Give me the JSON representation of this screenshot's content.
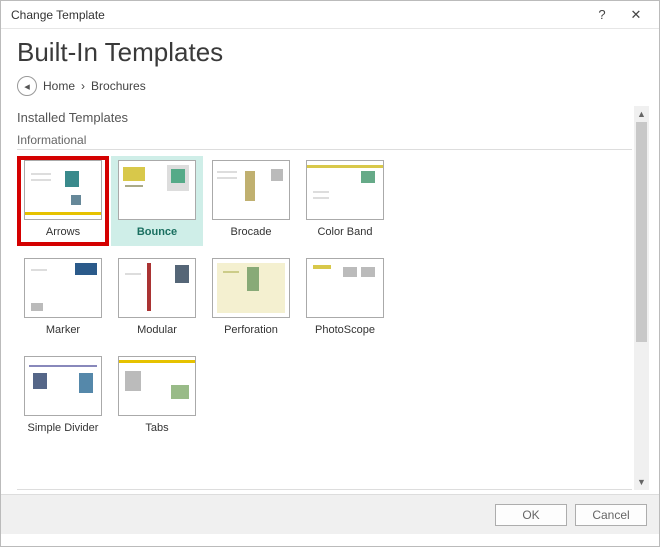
{
  "window": {
    "title": "Change Template",
    "help": "?",
    "close": "✕"
  },
  "heading": "Built-In Templates",
  "breadcrumb": {
    "back_icon": "◂",
    "home": "Home",
    "sep": "›",
    "current": "Brochures"
  },
  "sections": {
    "installed": "Installed Templates",
    "category": "Informational"
  },
  "templates": {
    "row1": [
      {
        "label": "Arrows"
      },
      {
        "label": "Bounce"
      },
      {
        "label": "Brocade"
      },
      {
        "label": "Color Band"
      }
    ],
    "row2": [
      {
        "label": "Marker"
      },
      {
        "label": "Modular"
      },
      {
        "label": "Perforation"
      },
      {
        "label": "PhotoScope"
      }
    ],
    "row3": [
      {
        "label": "Simple Divider"
      },
      {
        "label": "Tabs"
      }
    ]
  },
  "footer": {
    "ok": "OK",
    "cancel": "Cancel"
  }
}
